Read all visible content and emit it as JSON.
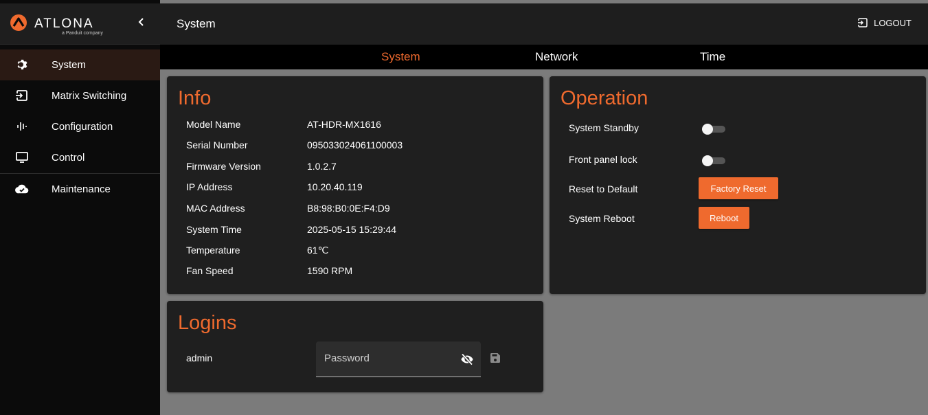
{
  "brand": {
    "name": "ATLONA",
    "sub": "a Panduit company",
    "accent": "#ef6a2e"
  },
  "sidebar": {
    "items": [
      {
        "label": "System",
        "icon": "gear-icon"
      },
      {
        "label": "Matrix Switching",
        "icon": "input-icon"
      },
      {
        "label": "Configuration",
        "icon": "audio-levels-icon"
      },
      {
        "label": "Control",
        "icon": "monitor-icon"
      },
      {
        "label": "Maintenance",
        "icon": "cloud-check-icon"
      }
    ],
    "active_index": 0
  },
  "header": {
    "title": "System",
    "logout_label": "LOGOUT"
  },
  "tabs": [
    {
      "label": "System",
      "active": true
    },
    {
      "label": "Network",
      "active": false
    },
    {
      "label": "Time",
      "active": false
    }
  ],
  "info": {
    "title": "Info",
    "rows": [
      {
        "key": "Model Name",
        "value": "AT-HDR-MX1616"
      },
      {
        "key": "Serial Number",
        "value": "095033024061100003"
      },
      {
        "key": "Firmware Version",
        "value": "1.0.2.7"
      },
      {
        "key": "IP Address",
        "value": "10.20.40.119"
      },
      {
        "key": "MAC Address",
        "value": "B8:98:B0:0E:F4:D9"
      },
      {
        "key": "System Time",
        "value": "2025-05-15 15:29:44"
      },
      {
        "key": "Temperature",
        "value": "61℃"
      },
      {
        "key": "Fan Speed",
        "value": "1590 RPM"
      }
    ]
  },
  "operation": {
    "title": "Operation",
    "standby_label": "System Standby",
    "standby_on": false,
    "lock_label": "Front panel lock",
    "lock_on": false,
    "reset_label": "Reset to Default",
    "reset_button": "Factory Reset",
    "reboot_label": "System Reboot",
    "reboot_button": "Reboot"
  },
  "logins": {
    "title": "Logins",
    "user": "admin",
    "password_placeholder": "Password"
  }
}
